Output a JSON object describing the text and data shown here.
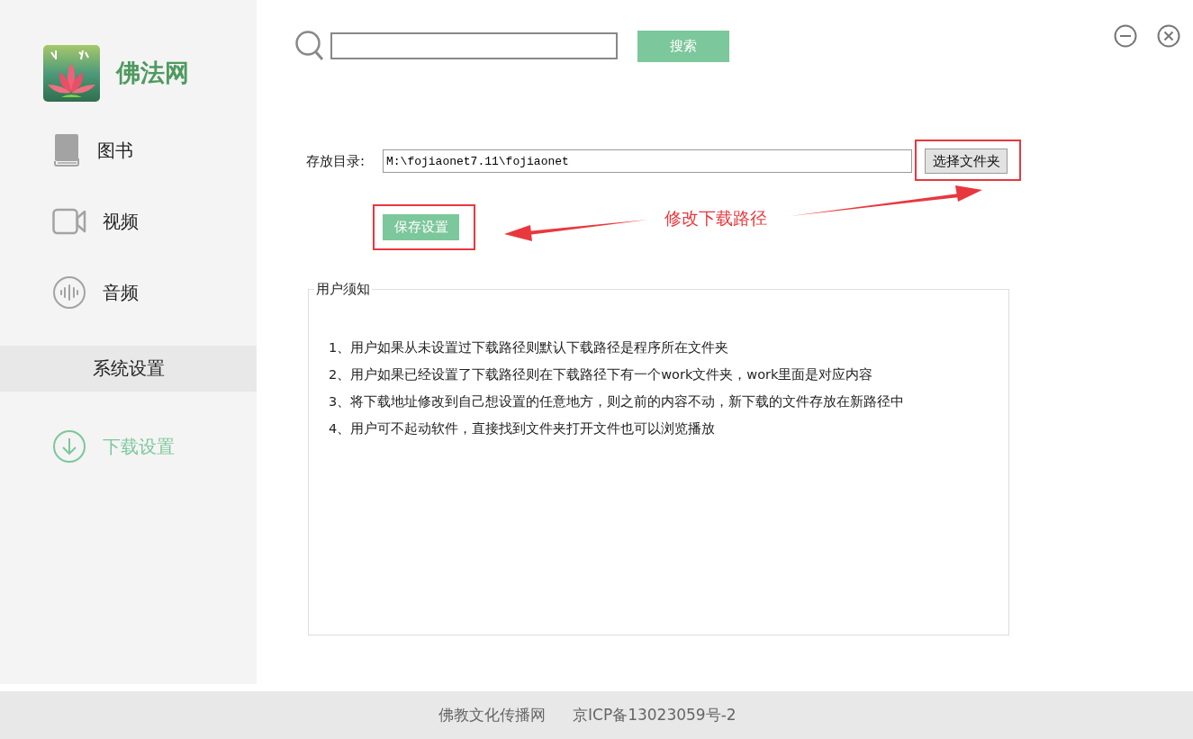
{
  "app": {
    "logo_text": "佛法网"
  },
  "sidebar": {
    "items": [
      {
        "label": "图书",
        "kind": "book",
        "selected": false
      },
      {
        "label": "视频",
        "kind": "video",
        "selected": false
      },
      {
        "label": "音频",
        "kind": "audio",
        "selected": false
      }
    ],
    "section": {
      "label": "系统设置"
    },
    "section_items": [
      {
        "label": "下载设置",
        "kind": "download",
        "selected": true
      }
    ]
  },
  "search": {
    "button": "搜索"
  },
  "settings": {
    "label": "存放目录:",
    "path": "M:\\fojiaonet7.11\\fojiaonet",
    "browse_button": "选择文件夹",
    "save_button": "保存设置"
  },
  "annotation": {
    "text": "修改下载路径"
  },
  "notice": {
    "title": "用户须知",
    "lines": [
      "1、用户如果从未设置过下载路径则默认下载路径是程序所在文件夹",
      "2、用户如果已经设置了下载路径则在下载路径下有一个work文件夹，work里面是对应内容",
      "3、将下载地址修改到自己想设置的任意地方，则之前的内容不动，新下载的文件存放在新路径中",
      "4、用户可不起动软件，直接找到文件夹打开文件也可以浏览播放"
    ]
  },
  "footer": {
    "items": [
      "佛教文化传播网",
      "京ICP备13023059号-2"
    ]
  }
}
